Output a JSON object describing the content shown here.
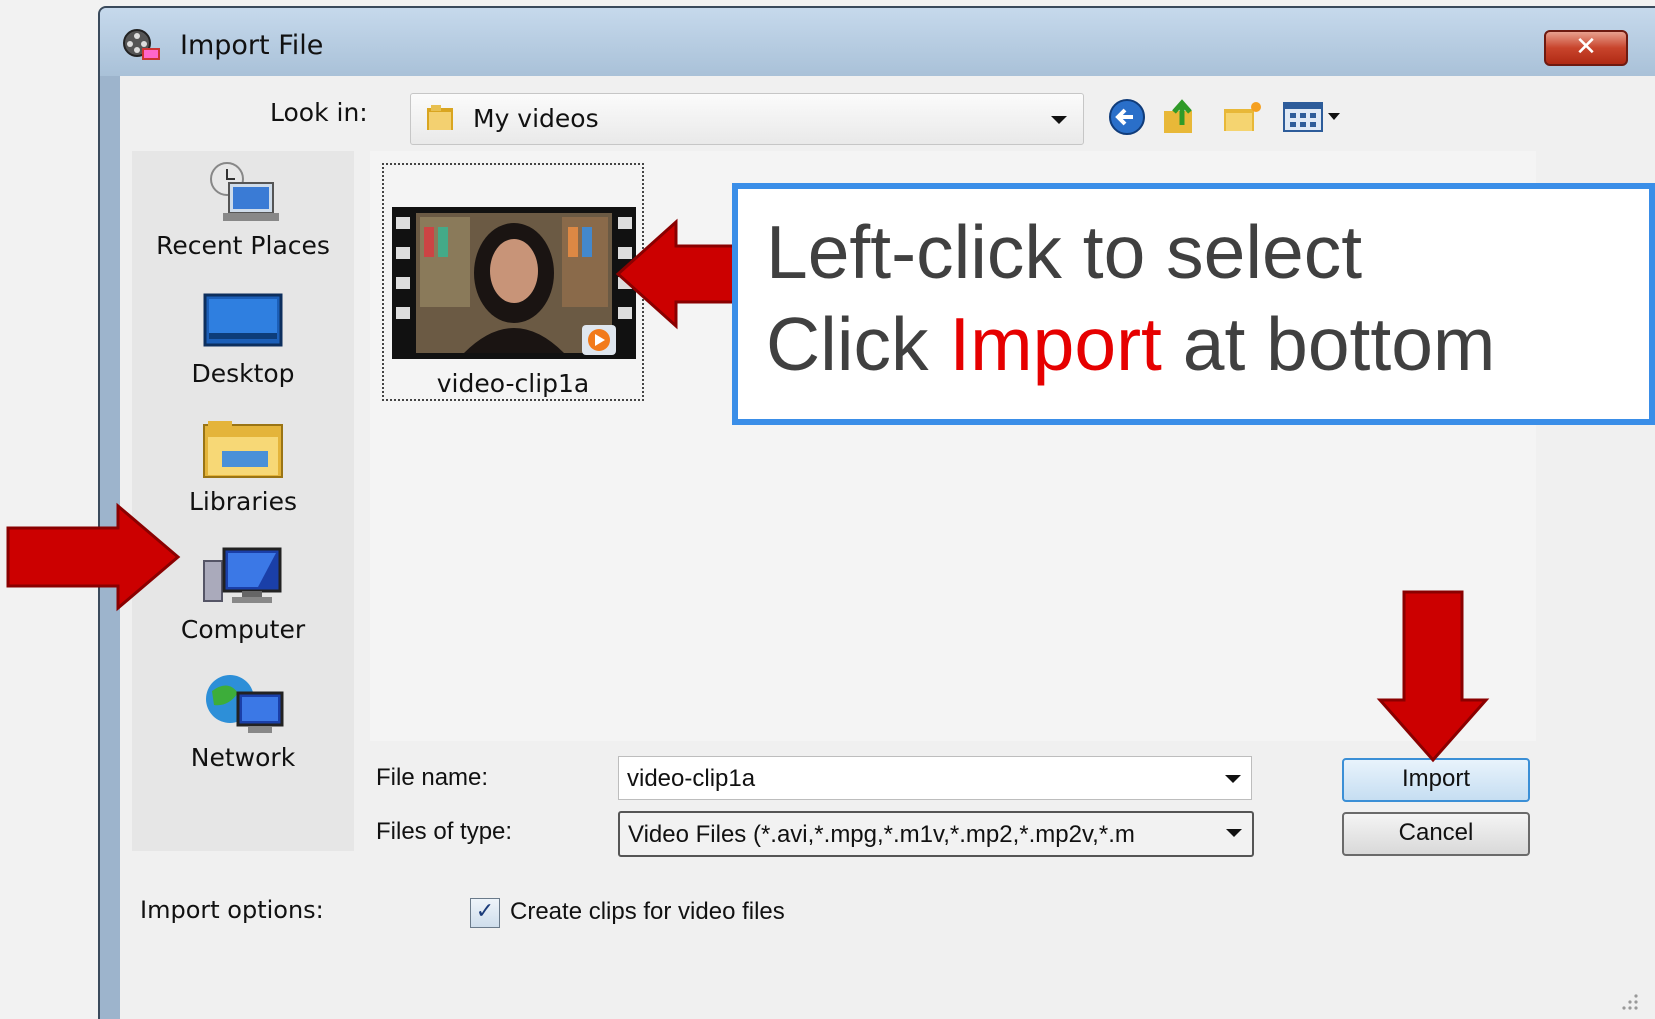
{
  "window": {
    "title": "Import File",
    "close_symbol": "✕"
  },
  "look_in": {
    "label": "Look in:",
    "value": "My videos"
  },
  "places": [
    {
      "label": "Recent Places",
      "icon": "recent-places-icon"
    },
    {
      "label": "Desktop",
      "icon": "desktop-icon"
    },
    {
      "label": "Libraries",
      "icon": "libraries-icon"
    },
    {
      "label": "Computer",
      "icon": "computer-icon"
    },
    {
      "label": "Network",
      "icon": "network-icon"
    }
  ],
  "files": [
    {
      "name": "video-clip1a",
      "icon": "video-thumbnail"
    }
  ],
  "form": {
    "file_name_label": "File name:",
    "file_name_value": "video-clip1a",
    "file_type_label": "Files of type:",
    "file_type_value": "Video Files (*.avi,*.mpg,*.m1v,*.mp2,*.mp2v,*.m"
  },
  "buttons": {
    "import": "Import",
    "cancel": "Cancel"
  },
  "import_options": {
    "label": "Import options:",
    "checkbox_label": "Create clips for video files",
    "checked": true,
    "check_mark": "✓"
  },
  "callout": {
    "line1": "Left-click to select",
    "line2_prefix": "Click ",
    "line2_highlight": "Import",
    "line2_suffix": " at bottom"
  },
  "colors": {
    "arrow": "#cc0000",
    "callout_border": "#3a8ee8",
    "highlight": "#e60000"
  }
}
